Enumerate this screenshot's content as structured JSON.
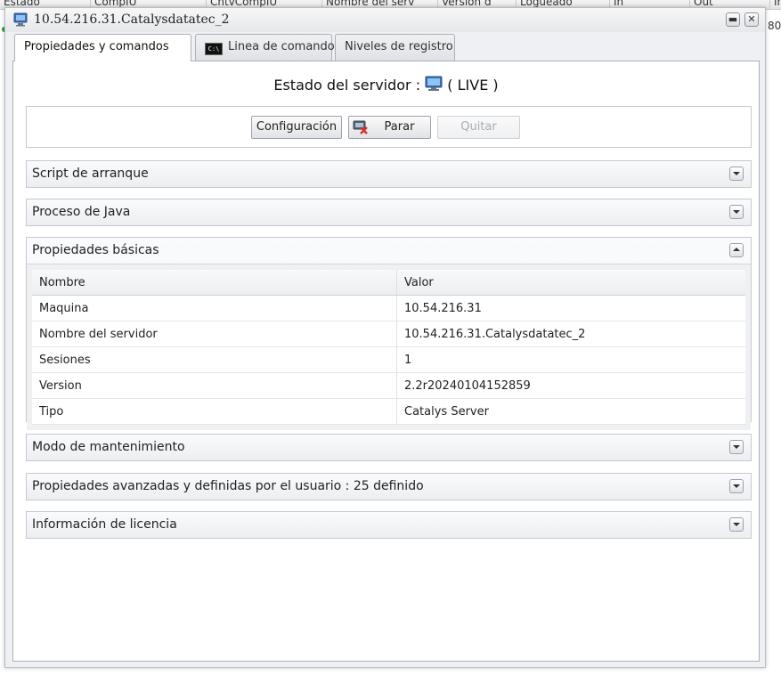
{
  "background": {
    "columns": [
      "Estado",
      "CompIU",
      "CntvCompIU",
      "Nombre del serv",
      "Version d",
      "Logueado",
      "In",
      "Out",
      "Ir"
    ],
    "row_right_value": "80"
  },
  "window": {
    "title": "10.54.216.31.Catalysdatatec_2",
    "minimize_label": "▬",
    "close_label": "✕"
  },
  "tabs": [
    {
      "label": "Propiedades y comandos",
      "active": true
    },
    {
      "label": "Linea de comando",
      "active": false
    },
    {
      "label": "Niveles de registro",
      "active": false
    }
  ],
  "server_status": {
    "label": "Estado del servidor :",
    "value": "( LIVE )"
  },
  "buttons": {
    "config": "Configuración",
    "stop": "Parar",
    "quit": "Quitar"
  },
  "sections": {
    "startup_script": "Script de arranque",
    "java_process": "Proceso de Java",
    "basic_properties": "Propiedades básicas",
    "maintenance_mode": "Modo de mantenimiento",
    "advanced_properties": "Propiedades avanzadas y definidas por el usuario : 25 definido",
    "license_info": "Información de licencia"
  },
  "properties_table": {
    "headers": [
      "Nombre",
      "Valor"
    ],
    "rows": [
      [
        "Maquina",
        "10.54.216.31"
      ],
      [
        "Nombre del servidor",
        "10.54.216.31.Catalysdatatec_2"
      ],
      [
        "Sesiones",
        "1"
      ],
      [
        "Version",
        "2.2r20240104152859"
      ],
      [
        "Tipo",
        "Catalys Server"
      ]
    ]
  },
  "colors": {
    "accent_live": "#2aa52a",
    "stop_icon_red": "#d9322b"
  }
}
